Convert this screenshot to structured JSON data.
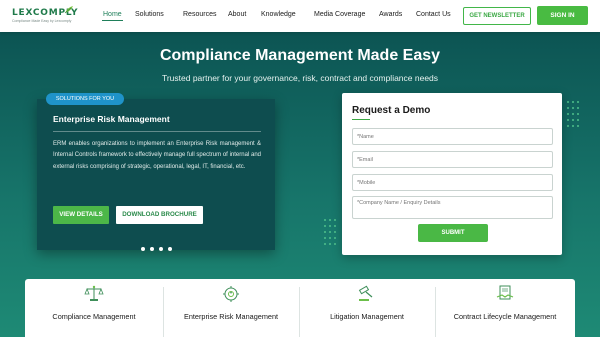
{
  "brand": {
    "name": "LEXCOMPLY",
    "tagline": "Compliance Made Easy by Lexcomply"
  },
  "nav": {
    "items": [
      {
        "label": "Home",
        "active": true
      },
      {
        "label": "Solutions"
      },
      {
        "label": "Resources"
      },
      {
        "label": "About"
      },
      {
        "label": "Knowledge"
      },
      {
        "label": "Media Coverage"
      },
      {
        "label": "Awards"
      },
      {
        "label": "Contact Us"
      }
    ],
    "newsletter_label": "GET NEWSLETTER",
    "signin_label": "SIGN IN"
  },
  "hero": {
    "title": "Compliance Management Made Easy",
    "subtitle": "Trusted partner for your governance, risk, contract and compliance needs"
  },
  "solution_card": {
    "badge": "SOLUTIONS FOR YOU",
    "title": "Enterprise Risk Management",
    "body": "ERM enables organizations to implement an Enterprise Risk management & Internal Controls framework to effectively manage full spectrum of internal and external risks comprising of strategic, operational, legal, IT, financial, etc.",
    "view_label": "VIEW DETAILS",
    "brochure_label": "DOWNLOAD BROCHURE",
    "slide_count": 4
  },
  "demo_form": {
    "title": "Request a Demo",
    "fields": [
      {
        "placeholder": "*Name"
      },
      {
        "placeholder": "*Email"
      },
      {
        "placeholder": "*Mobile"
      },
      {
        "placeholder": "*Company Name / Enquiry Details"
      }
    ],
    "submit_label": "SUBMIT"
  },
  "services": [
    {
      "label": "Compliance Management",
      "icon": "scales-icon"
    },
    {
      "label": "Enterprise Risk Management",
      "icon": "risk-gear-icon"
    },
    {
      "label": "Litigation Management",
      "icon": "gavel-icon"
    },
    {
      "label": "Contract Lifecycle Management",
      "icon": "handshake-document-icon"
    }
  ],
  "colors": {
    "brand_green": "#49bb42",
    "hero_teal": "#0c5453",
    "badge_blue": "#1f93c9"
  }
}
